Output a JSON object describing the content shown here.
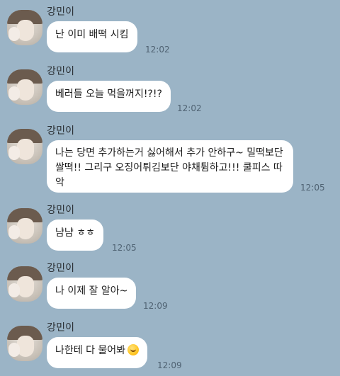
{
  "sender_name": "강민이",
  "messages": [
    {
      "text": "난 이미 배떡 시킴",
      "time": "12:02"
    },
    {
      "text": "베러들 오늘 먹을꺼지!?!?",
      "time": "12:02"
    },
    {
      "text": "나는 당면 추가하는거 싫어해서 추가 안하구~ 밀떡보단 쌀떡!!   그리구 오징어튀김보단 야채튐하고!!! 쿨피스 따악",
      "time": "12:05"
    },
    {
      "text": "냠냠 ㅎㅎ",
      "time": "12:05"
    },
    {
      "text": "나 이제 잘 알아~",
      "time": "12:09"
    },
    {
      "text": "나한테 다 물어봐",
      "time": "12:09",
      "emoji": "yum-face-emoji"
    }
  ],
  "colors": {
    "background": "#9bb4c6",
    "bubble": "#ffffff",
    "time": "#4f6272"
  }
}
